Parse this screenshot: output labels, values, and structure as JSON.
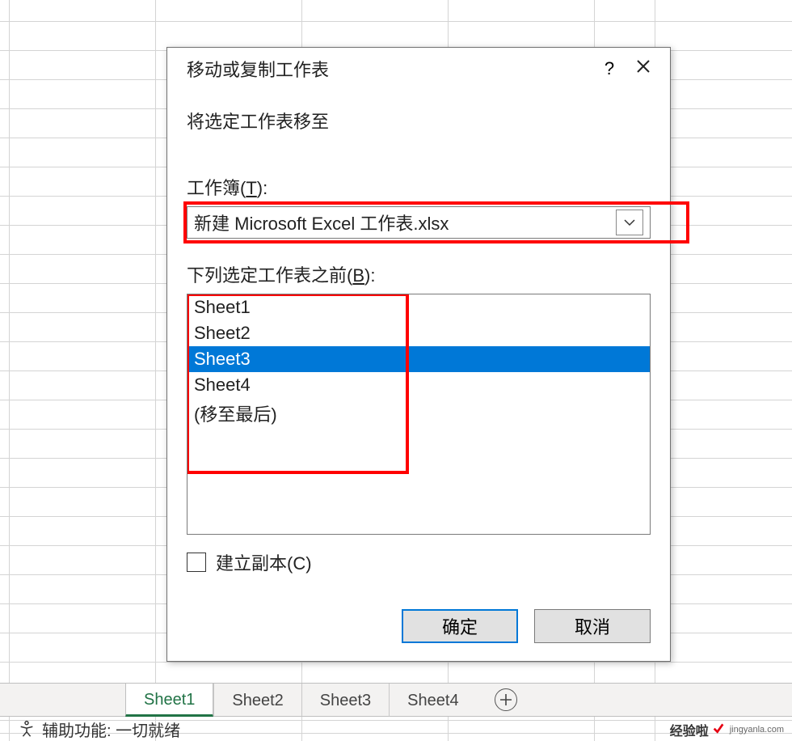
{
  "dialog": {
    "title": "移动或复制工作表",
    "help_symbol": "?",
    "instruction": "将选定工作表移至",
    "workbook_label_pre": "工作簿(",
    "workbook_label_key": "T",
    "workbook_label_post": "):",
    "workbook_value": "新建 Microsoft Excel 工作表.xlsx",
    "before_label_pre": "下列选定工作表之前(",
    "before_label_key": "B",
    "before_label_post": "):",
    "sheets": [
      {
        "label": "Sheet1",
        "selected": false
      },
      {
        "label": "Sheet2",
        "selected": false
      },
      {
        "label": "Sheet3",
        "selected": true
      },
      {
        "label": "Sheet4",
        "selected": false
      },
      {
        "label": "(移至最后)",
        "selected": false
      }
    ],
    "copy_label_pre": "建立副本(",
    "copy_label_key": "C",
    "copy_label_post": ")",
    "copy_checked": false,
    "ok_label": "确定",
    "cancel_label": "取消"
  },
  "tabs": [
    {
      "label": "Sheet1",
      "active": true
    },
    {
      "label": "Sheet2",
      "active": false
    },
    {
      "label": "Sheet3",
      "active": false
    },
    {
      "label": "Sheet4",
      "active": false
    }
  ],
  "status_text": "辅助功能: 一切就绪",
  "watermark": {
    "zh": "经验啦",
    "domain": "jingyanla.com"
  }
}
